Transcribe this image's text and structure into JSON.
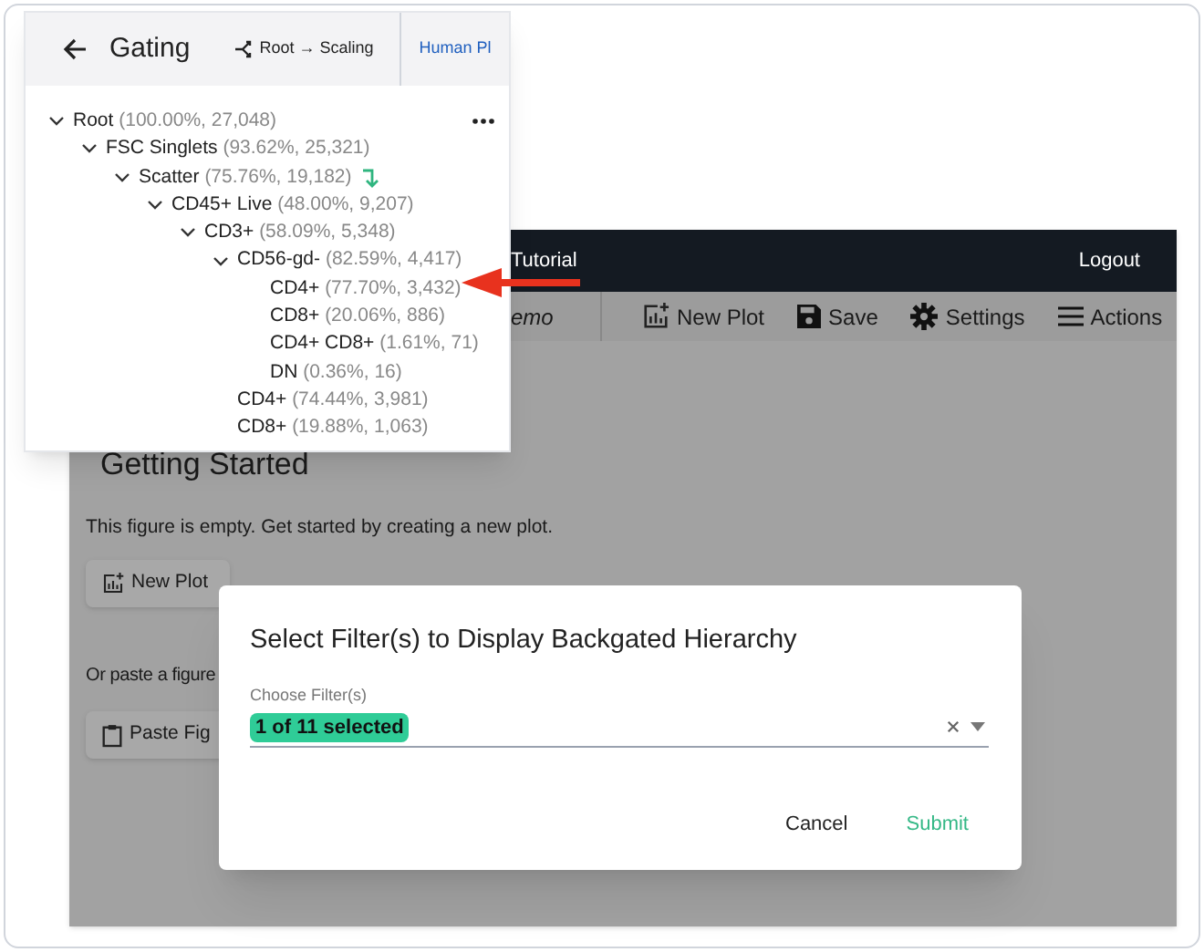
{
  "app": {
    "nav": [
      {
        "label": "Tutorial"
      },
      {
        "label": "Logout"
      }
    ],
    "toolbar": {
      "figure_name": "emo",
      "buttons": [
        {
          "label": "New Plot",
          "kind": "plot"
        },
        {
          "label": "Save",
          "kind": "save"
        },
        {
          "label": "Settings",
          "kind": "settings"
        },
        {
          "label": "Actions",
          "kind": "menu"
        }
      ]
    },
    "content": {
      "heading": "Getting Started",
      "intro": "This figure is empty. Get started by creating a new plot.",
      "new_plot_button": "New Plot",
      "paste_hint": "Or paste a figure",
      "paste_button": "Paste Fig"
    }
  },
  "gating_panel": {
    "title": "Gating",
    "path": "Root → Scaling",
    "tab": "Human Pl",
    "tree": [
      {
        "name": "Root",
        "stats": "(100.00%, 27,048)",
        "expanded": true,
        "backgated": false,
        "children": [
          {
            "name": "FSC Singlets",
            "stats": "(93.62%, 25,321)",
            "expanded": true,
            "backgated": false,
            "children": [
              {
                "name": "Scatter",
                "stats": "(75.76%, 19,182)",
                "expanded": true,
                "backgated": true,
                "children": [
                  {
                    "name": "CD45+ Live",
                    "stats": "(48.00%, 9,207)",
                    "expanded": true,
                    "backgated": false,
                    "children": [
                      {
                        "name": "CD3+",
                        "stats": "(58.09%, 5,348)",
                        "expanded": true,
                        "backgated": false,
                        "children": [
                          {
                            "name": "CD56-gd-",
                            "stats": "(82.59%, 4,417)",
                            "expanded": true,
                            "backgated": false,
                            "children": [
                              {
                                "name": "CD4+",
                                "stats": "(77.70%, 3,432)",
                                "backgated": false
                              },
                              {
                                "name": "CD8+",
                                "stats": "(20.06%, 886)",
                                "backgated": false
                              },
                              {
                                "name": "CD4+ CD8+",
                                "stats": "(1.61%, 71)",
                                "backgated": false
                              },
                              {
                                "name": "DN",
                                "stats": "(0.36%, 16)",
                                "backgated": false
                              }
                            ]
                          },
                          {
                            "name": "CD4+",
                            "stats": "(74.44%, 3,981)",
                            "backgated": false
                          },
                          {
                            "name": "CD8+",
                            "stats": "(19.88%, 1,063)",
                            "backgated": false
                          }
                        ]
                      }
                    ]
                  }
                ]
              }
            ]
          }
        ]
      }
    ]
  },
  "dialog": {
    "title": "Select Filter(s) to Display Backgated Hierarchy",
    "field_label": "Choose Filter(s)",
    "chip": "1 of 11 selected",
    "buttons": [
      {
        "label": "Cancel",
        "kind": "cancel"
      },
      {
        "label": "Submit",
        "kind": "submit"
      }
    ]
  }
}
